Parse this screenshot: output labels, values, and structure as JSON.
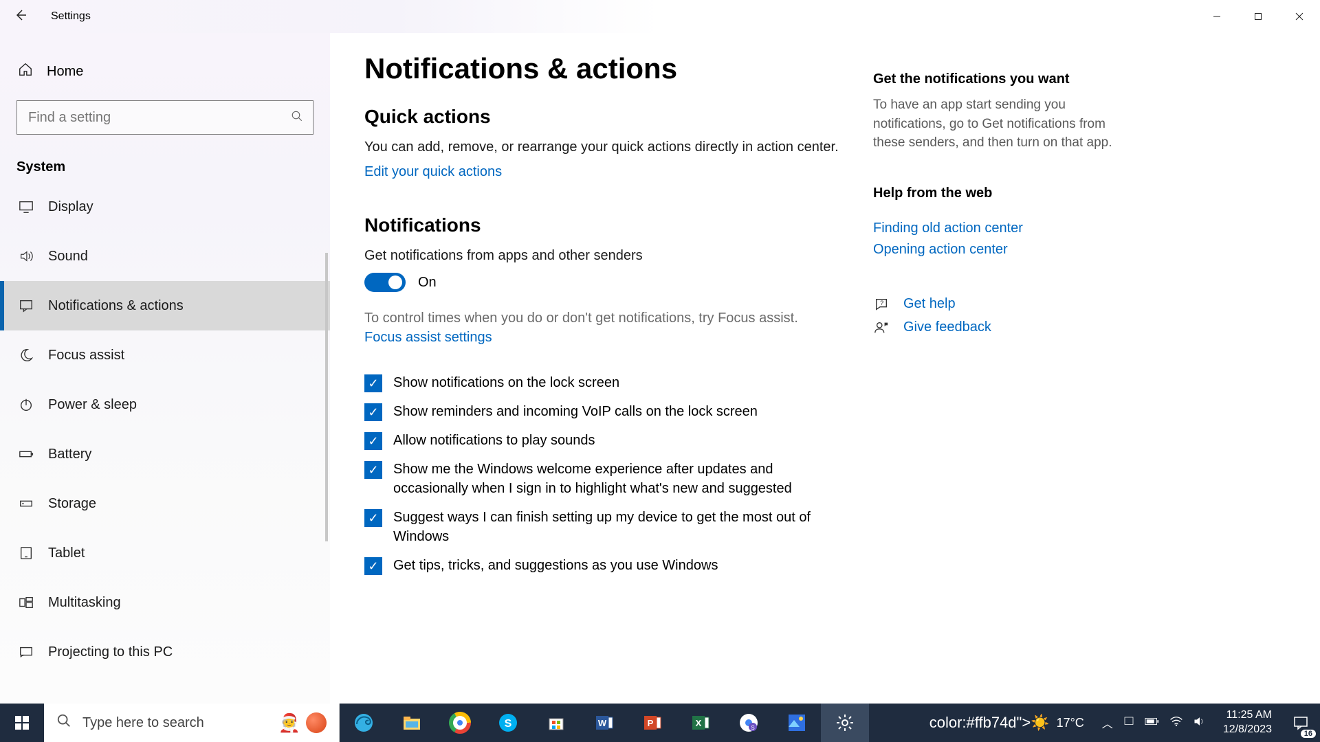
{
  "window": {
    "title": "Settings"
  },
  "sidebar": {
    "home": "Home",
    "search_placeholder": "Find a setting",
    "group": "System",
    "items": [
      {
        "label": "Display",
        "icon": "display"
      },
      {
        "label": "Sound",
        "icon": "sound"
      },
      {
        "label": "Notifications & actions",
        "icon": "notifications",
        "selected": true
      },
      {
        "label": "Focus assist",
        "icon": "moon"
      },
      {
        "label": "Power & sleep",
        "icon": "power"
      },
      {
        "label": "Battery",
        "icon": "battery"
      },
      {
        "label": "Storage",
        "icon": "storage"
      },
      {
        "label": "Tablet",
        "icon": "tablet"
      },
      {
        "label": "Multitasking",
        "icon": "multitasking"
      },
      {
        "label": "Projecting to this PC",
        "icon": "projecting"
      }
    ]
  },
  "main": {
    "page_title": "Notifications & actions",
    "quick_actions": {
      "heading": "Quick actions",
      "desc": "You can add, remove, or rearrange your quick actions directly in action center.",
      "link": "Edit your quick actions"
    },
    "notifications": {
      "heading": "Notifications",
      "toggle_label": "Get notifications from apps and other senders",
      "toggle_state": "On",
      "focus_hint": "To control times when you do or don't get notifications, try Focus assist.",
      "focus_link": "Focus assist settings",
      "checkboxes": [
        "Show notifications on the lock screen",
        "Show reminders and incoming VoIP calls on the lock screen",
        "Allow notifications to play sounds",
        "Show me the Windows welcome experience after updates and occasionally when I sign in to highlight what's new and suggested",
        "Suggest ways I can finish setting up my device to get the most out of Windows",
        "Get tips, tricks, and suggestions as you use Windows"
      ]
    }
  },
  "aside": {
    "tip_heading": "Get the notifications you want",
    "tip_body": "To have an app start sending you notifications, go to Get notifications from these senders, and then turn on that app.",
    "help_heading": "Help from the web",
    "help_links": [
      "Finding old action center",
      "Opening action center"
    ],
    "get_help": "Get help",
    "give_feedback": "Give feedback"
  },
  "taskbar": {
    "search_placeholder": "Type here to search",
    "weather_temp": "17°C",
    "time": "11:25 AM",
    "date": "12/8/2023",
    "notification_count": "16"
  }
}
